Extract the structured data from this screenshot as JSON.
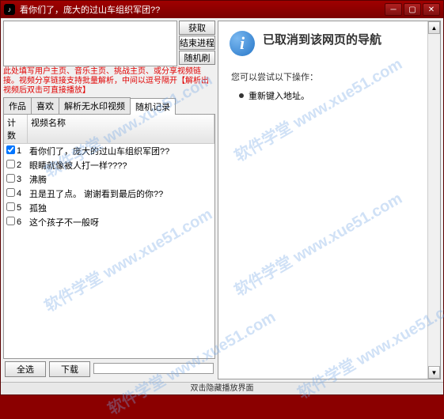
{
  "title": "看你们了，庞大的过山车组织军团??",
  "buttons": {
    "get": "获取",
    "end": "结束进程",
    "rand": "随机刷"
  },
  "note": "此处填写用户主页、音乐主页、挑战主页、或分享视频链接。视频分享链接支持批量解析，中间以逗号隔开【解析出视频后双击可直接播放】",
  "tabs": [
    "作品",
    "喜欢",
    "解析无水印视频",
    "随机记录"
  ],
  "active_tab": 3,
  "columns": {
    "num": "计数",
    "name": "视频名称"
  },
  "rows": [
    {
      "n": "1",
      "checked": true,
      "name": "看你们了，庞大的过山车组织军团??"
    },
    {
      "n": "2",
      "checked": false,
      "name": "眼睛就像被人打一样????"
    },
    {
      "n": "3",
      "checked": false,
      "name": "沸腾"
    },
    {
      "n": "4",
      "checked": false,
      "name": "丑是丑了点。      谢谢看到最后的你??"
    },
    {
      "n": "5",
      "checked": false,
      "name": "孤独"
    },
    {
      "n": "6",
      "checked": false,
      "name": "这个孩子不一般呀"
    }
  ],
  "bottom": {
    "selall": "全选",
    "download": "下载"
  },
  "right": {
    "heading": "已取消到该网页的导航",
    "sub": "您可以尝试以下操作：",
    "bullet": "重新键入地址。"
  },
  "status": "双击隐藏播放界面",
  "watermark": "软件学堂 www.xue51.com"
}
